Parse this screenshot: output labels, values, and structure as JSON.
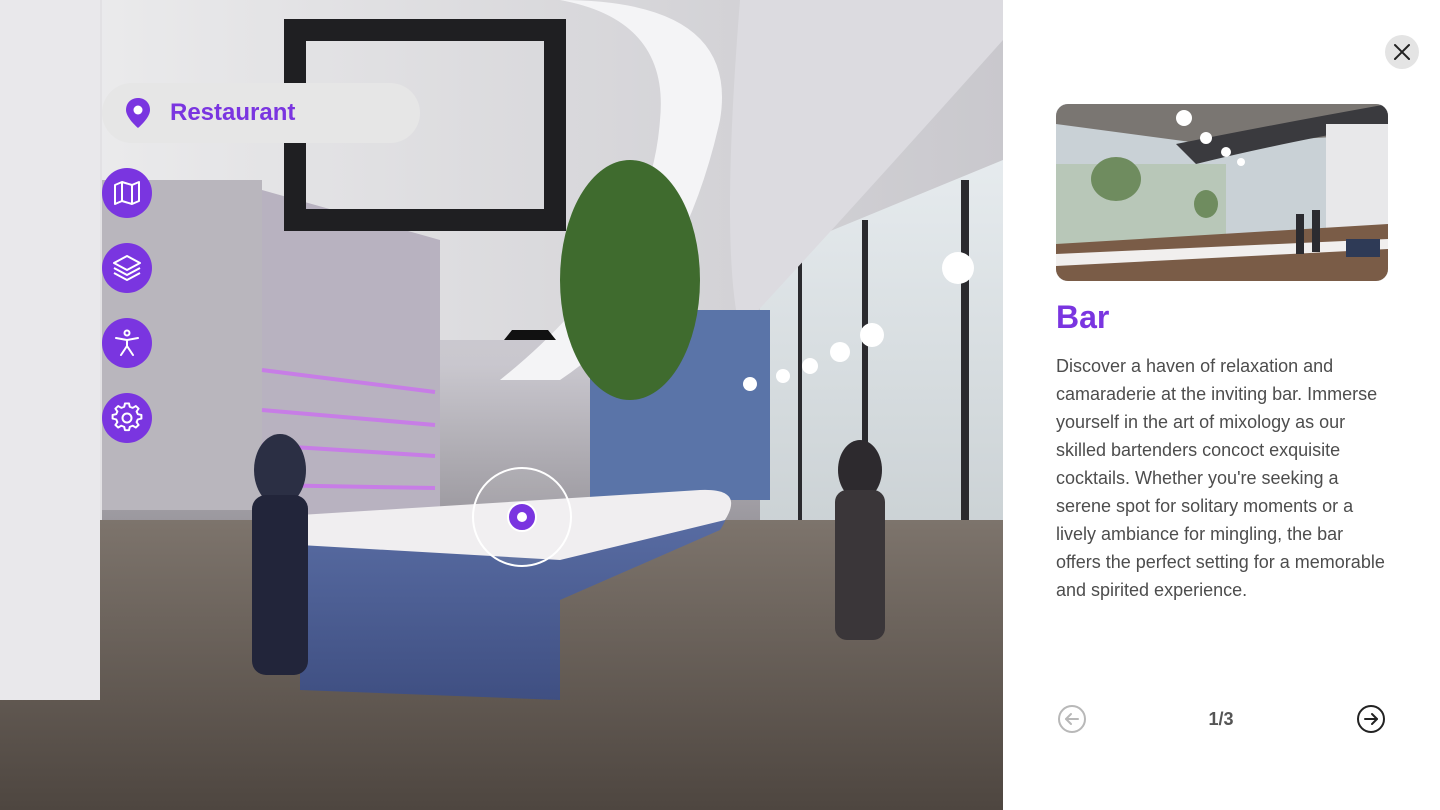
{
  "scene": {
    "location_label": "Restaurant",
    "location_icon": "map-pin-icon",
    "accent_color": "#7a35e0",
    "tools": [
      {
        "name": "map",
        "icon": "map-icon"
      },
      {
        "name": "layers",
        "icon": "layers-icon"
      },
      {
        "name": "accessibility",
        "icon": "accessibility-icon"
      },
      {
        "name": "settings",
        "icon": "gear-icon"
      }
    ]
  },
  "panel": {
    "title": "Bar",
    "description": "Discover a haven of relaxation and camaraderie at the inviting bar. Immerse yourself in the art of mixology as our skilled bartenders concoct exquisite cocktails. Whether you're seeking a serene spot for solitary moments or a lively ambiance for mingling, the bar offers the perfect setting for a memorable and spirited experience.",
    "pagination": "1/3",
    "close_icon": "close-icon",
    "prev_icon": "arrow-left-circle-icon",
    "next_icon": "arrow-right-circle-icon"
  }
}
